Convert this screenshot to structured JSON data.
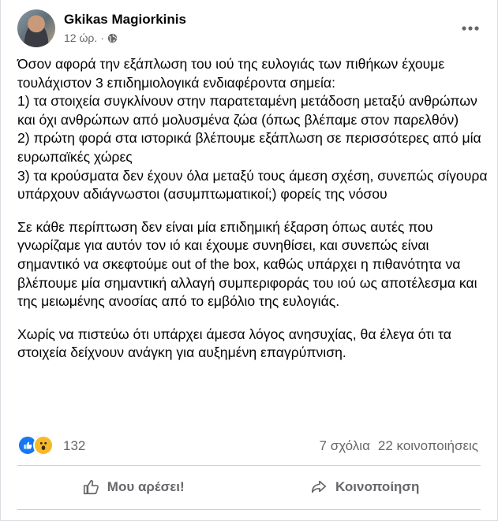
{
  "post": {
    "author": "Gkikas Magiorkinis",
    "time": "12 ώρ.",
    "time_separator": "·",
    "paragraphs": [
      "Όσον αφορά την εξάπλωση του ιού της ευλογιάς των πιθήκων έχουμε τουλάχιστον 3 επιδημιολογικά ενδιαφέροντα σημεία:\n1) τα στοιχεία συγκλίνουν στην παρατεταμένη μετάδοση μεταξύ ανθρώπων και όχι ανθρώπων από μολυσμένα ζώα (όπως βλέπαμε στον παρελθόν)\n2) πρώτη φορά στα ιστορικά βλέπουμε εξάπλωση σε περισσότερες από μία ευρωπαϊκές χώρες\n3) τα κρούσματα δεν έχουν όλα μεταξύ τους άμεση σχέση, συνεπώς σίγουρα υπάρχουν αδιάγνωστοι (ασυμπτωματικοί;) φορείς της νόσου",
      "Σε κάθε περίπτωση δεν είναι μία επιδημική έξαρση όπως αυτές που γνωρίζαμε για αυτόν τον ιό και έχουμε συνηθίσει, και συνεπώς είναι σημαντικό να σκεφτούμε out of the box, καθώς υπάρχει η πιθανότητα να βλέπουμε μία σημαντική αλλαγή συμπεριφοράς του ιού ως αποτέλεσμα και της μειωμένης ανοσίας από το εμβόλιο της ευλογιάς.",
      "Χωρίς να πιστεύω ότι υπάρχει άμεσα λόγος ανησυχίας, θα έλεγα ότι τα στοιχεία δείχνουν ανάγκη για αυξημένη επαγρύπνιση."
    ],
    "reaction_count": "132",
    "comments": "7 σχόλια",
    "shares": "22 κοινοποιήσεις"
  },
  "actions": {
    "like_label": "Μου αρέσει!",
    "share_label": "Κοινοποίηση"
  },
  "icons": [
    "globe-icon",
    "more-options-icon",
    "like-reaction-icon",
    "wow-reaction-icon",
    "thumbs-up-icon",
    "share-arrow-icon"
  ],
  "colors": {
    "like_blue": "#1877f2",
    "wow_yellow": "#f7b928",
    "secondary_text": "#65676b"
  }
}
